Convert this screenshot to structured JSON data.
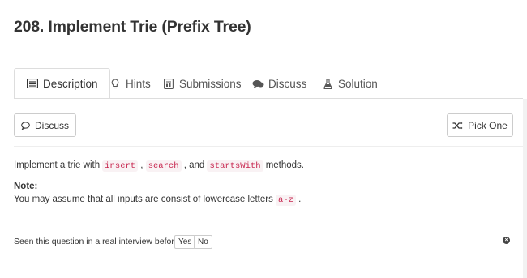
{
  "page": {
    "title": "208. Implement Trie (Prefix Tree)"
  },
  "tabs": [
    {
      "label": "Description",
      "icon": "document-icon",
      "active": true
    },
    {
      "label": "Hints",
      "icon": "lightbulb-icon"
    },
    {
      "label": "Submissions",
      "icon": "submissions-icon"
    },
    {
      "label": "Discuss",
      "icon": "comments-icon"
    },
    {
      "label": "Solution",
      "icon": "flask-icon"
    }
  ],
  "toolbar": {
    "discuss_label": "Discuss",
    "pick_one_label": "Pick One"
  },
  "problem": {
    "text_1": "Implement a trie with ",
    "code_insert": "insert",
    "sep_1": " , ",
    "code_search": "search",
    "sep_2": " , and ",
    "code_startswith": "startsWith",
    "text_2": " methods.",
    "note_label": "Note:",
    "note_text": "You may assume that all inputs are consist of lowercase letters ",
    "note_code": "a-z",
    "note_end": " ."
  },
  "interview": {
    "question": "Seen this question in a real interview before?",
    "yes_label": "Yes",
    "no_label": "No",
    "close_glyph": "×"
  },
  "colors": {
    "code_text": "#c7254e",
    "code_bg": "#f9f2f4",
    "border": "#dddddd"
  }
}
